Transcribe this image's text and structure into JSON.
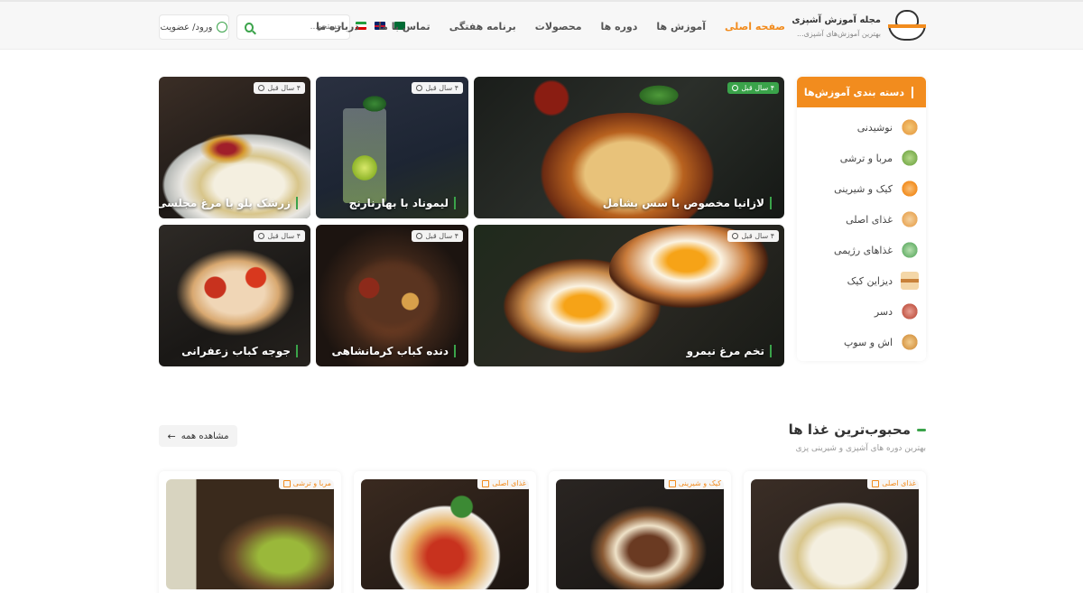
{
  "header": {
    "logo_title": "مجله آموزش آشپزی",
    "logo_subtitle": "بهترین آموزش‌های آشپزی...",
    "login_label": "ورود/ عضویت",
    "search_placeholder": "جستجو...",
    "nav": [
      {
        "label": "صفحه اصلی",
        "active": true
      },
      {
        "label": "آموزش ها",
        "active": false
      },
      {
        "label": "دوره ها",
        "active": false
      },
      {
        "label": "محصولات",
        "active": false
      },
      {
        "label": "برنامه هفتگی",
        "active": false
      },
      {
        "label": "تماس با ما",
        "active": false
      },
      {
        "label": "درباره ما",
        "active": false
      }
    ]
  },
  "hero": [
    {
      "title": "لازانیا مخصوص با سس بشامل",
      "time": "۴ سال قبل"
    },
    {
      "title": "لیموناد با بهارنارنج",
      "time": "۴ سال قبل"
    },
    {
      "title": "زرشک پلو با مرغ مجلسی",
      "time": "۴ سال قبل"
    },
    {
      "title": "تخم مرغ نیمرو",
      "time": "۴ سال قبل"
    },
    {
      "title": "دنده کباب کرمانشاهی",
      "time": "۴ سال قبل"
    },
    {
      "title": "جوجه کباب زعفرانی",
      "time": "۴ سال قبل"
    }
  ],
  "sidebar": {
    "title": "دسته بندی آموزش‌ها",
    "items": [
      {
        "label": "نوشیدنی",
        "color": "#e8a24a"
      },
      {
        "label": "مربا و ترشی",
        "color": "#7cae4f"
      },
      {
        "label": "کیک و شیرینی",
        "color": "#f28c1e"
      },
      {
        "label": "غذای اصلی",
        "color": "#e9a85a"
      },
      {
        "label": "غذاهای رژیمی",
        "color": "#6bb36e"
      },
      {
        "label": "دیزاین کیک",
        "color": "#c9823a"
      },
      {
        "label": "دسر",
        "color": "#c45a4a"
      },
      {
        "label": "اش و سوپ",
        "color": "#d89a4a"
      }
    ]
  },
  "popular": {
    "title": "محبوب‌ترین غذا ها",
    "subtitle": "بهترین دوره های آشپزی و شیرینی پزی",
    "view_all": "مشاهده همه",
    "cards": [
      {
        "category": "غذای اصلی"
      },
      {
        "category": "کیک و شیرینی"
      },
      {
        "category": "غذای اصلی"
      },
      {
        "category": "مربا و ترشی"
      }
    ]
  },
  "colors": {
    "accent": "#f28c1e",
    "green": "#3aa34a"
  }
}
